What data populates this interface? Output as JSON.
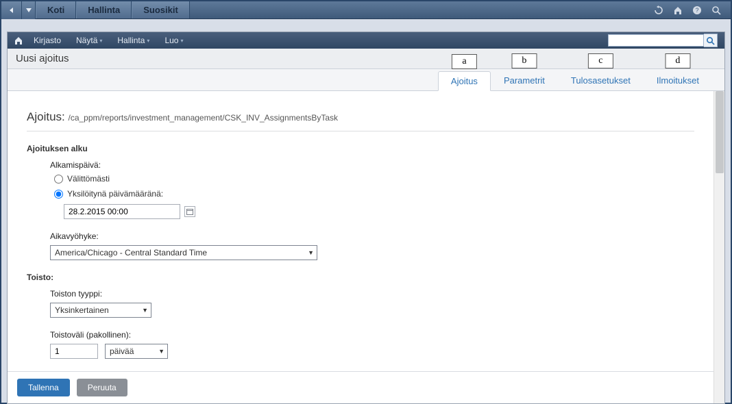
{
  "topbar": {
    "tabs": [
      "Koti",
      "Hallinta",
      "Suosikit"
    ]
  },
  "menubar": {
    "items": [
      "Kirjasto",
      "Näytä",
      "Hallinta",
      "Luo"
    ],
    "search_placeholder": ""
  },
  "page_title": "Uusi ajoitus",
  "tabs": {
    "items": [
      {
        "label": "Ajoitus",
        "letter": "a",
        "active": true
      },
      {
        "label": "Parametrit",
        "letter": "b",
        "active": false
      },
      {
        "label": "Tulosasetukset",
        "letter": "c",
        "active": false
      },
      {
        "label": "Ilmoitukset",
        "letter": "d",
        "active": false
      }
    ]
  },
  "section": {
    "heading": "Ajoitus:",
    "path": "/ca_ppm/reports/investment_management/CSK_INV_AssignmentsByTask"
  },
  "start": {
    "group_label": "Ajoituksen alku",
    "start_date_label": "Alkamispäivä:",
    "radio_immediate": "Välittömästi",
    "radio_specific": "Yksilöitynä päivämääränä:",
    "selected": "specific",
    "datetime_value": "28.2.2015 00:00",
    "timezone_label": "Aikavyöhyke:",
    "timezone_value": "America/Chicago - Central Standard Time"
  },
  "repeat": {
    "group_label": "Toisto:",
    "type_label": "Toiston tyyppi:",
    "type_value": "Yksinkertainen",
    "interval_label": "Toistoväli (pakollinen):",
    "interval_value": "1",
    "interval_unit": "päivää"
  },
  "footer": {
    "save": "Tallenna",
    "cancel": "Peruuta"
  }
}
